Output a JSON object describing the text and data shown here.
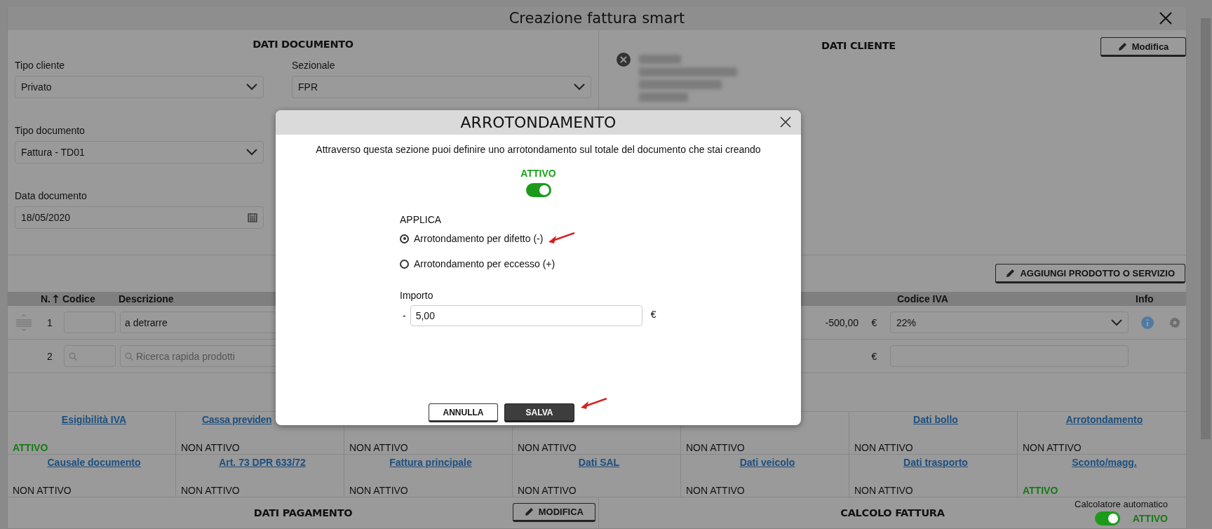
{
  "window": {
    "title": "Creazione fattura smart"
  },
  "dati_documento": {
    "heading": "DATI DOCUMENTO",
    "columns": [
      [
        {
          "label": "Tipo cliente",
          "value": "Privato",
          "kind": "select"
        },
        {
          "label": "Tipo documento",
          "value": "Fattura - TD01",
          "kind": "select"
        },
        {
          "label": "Data documento",
          "value": "18/05/2020",
          "kind": "date"
        }
      ],
      [
        {
          "label": "Sezionale",
          "value": "FPR",
          "kind": "select"
        }
      ]
    ]
  },
  "dati_cliente": {
    "heading": "DATI CLIENTE",
    "edit_button": "Modifica"
  },
  "products": {
    "add_button": "AGGIUNGI PRODOTTO O SERVIZIO",
    "columns": [
      "N.",
      "Codice",
      "Descrizione",
      "Codice IVA",
      "Info"
    ],
    "rows": [
      {
        "n": "1",
        "kind": "item",
        "description": "a detrarre",
        "amount": "-500,00",
        "currency": "€",
        "vat": "22%"
      },
      {
        "n": "2",
        "kind": "search",
        "placeholder": "Ricerca rapida prodotti",
        "currency": "€"
      }
    ]
  },
  "options": [
    [
      {
        "label": "Esigibilità IVA",
        "value": "ATTIVO",
        "active": true
      },
      {
        "label": "Cassa previden",
        "cut": true,
        "value": "NON ATTIVO",
        "active": false
      },
      {
        "value": "NON ATTIVO",
        "active": false
      },
      {
        "value": "NON ATTIVO",
        "active": false
      },
      {
        "value": "NON ATTIVO",
        "active": false
      },
      {
        "label": "Dati bollo",
        "value": "NON ATTIVO",
        "active": false
      },
      {
        "label": "Arrotondamento",
        "value": "NON ATTIVO",
        "active": false
      }
    ],
    [
      {
        "label": "Causale documento",
        "value": "NON ATTIVO",
        "active": false
      },
      {
        "label": "Art. 73 DPR 633/72",
        "value": "NON ATTIVO",
        "active": false
      },
      {
        "label": "Fattura principale",
        "value": "NON ATTIVO",
        "active": false
      },
      {
        "label": "Dati SAL",
        "value": "NON ATTIVO",
        "active": false
      },
      {
        "label": "Dati veicolo",
        "value": "NON ATTIVO",
        "active": false
      },
      {
        "label": "Dati trasporto",
        "value": "NON ATTIVO",
        "active": false
      },
      {
        "label": "Sconto/magg.",
        "value": "ATTIVO",
        "active": true
      }
    ]
  ],
  "dati_pagamento": {
    "heading": "DATI PAGAMENTO",
    "edit_button": "MODIFICA"
  },
  "calcolo_fattura": {
    "heading": "CALCOLO FATTURA",
    "auto_label": "Calcolatore automatico",
    "on": true,
    "status": "ATTIVO"
  },
  "dialog": {
    "title": "ARROTONDAMENTO",
    "description": "Attraverso questa sezione puoi definire uno arrotondamento sul totale del documento che stai creando",
    "status": "ATTIVO",
    "on": true,
    "apply_label": "APPLICA",
    "options": [
      {
        "label": "Arrotondamento per difetto (-)",
        "selected": true
      },
      {
        "label": "Arrotondamento per eccesso (+)",
        "selected": false
      }
    ],
    "amount_label": "Importo",
    "sign": "-",
    "amount": "5,00",
    "currency": "€",
    "buttons": [
      {
        "label": "ANNULLA",
        "kind": "secondary"
      },
      {
        "label": "SALVA",
        "kind": "primary"
      }
    ]
  }
}
